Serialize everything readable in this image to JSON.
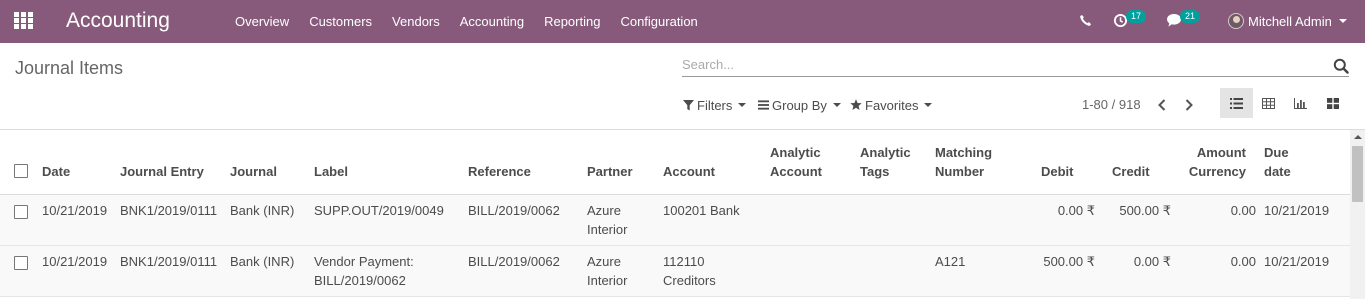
{
  "navbar": {
    "app_title": "Accounting",
    "menu": [
      "Overview",
      "Customers",
      "Vendors",
      "Accounting",
      "Reporting",
      "Configuration"
    ],
    "activity_count": "17",
    "message_count": "21",
    "user_name": "Mitchell Admin",
    "bg_color": "#875a7b",
    "badge_color": "#00a09d"
  },
  "control_panel": {
    "title": "Journal Items",
    "search_placeholder": "Search...",
    "filters_label": "Filters",
    "group_by_label": "Group By",
    "favorites_label": "Favorites",
    "pager": "1-80 / 918",
    "views": [
      "list-view-icon",
      "pivot-view-icon",
      "graph-view-icon",
      "kanban-view-icon"
    ]
  },
  "table": {
    "headers": {
      "date": "Date",
      "journal_entry": "Journal Entry",
      "journal": "Journal",
      "label": "Label",
      "reference": "Reference",
      "partner": "Partner",
      "account": "Account",
      "analytic_account": [
        "Analytic",
        "Account"
      ],
      "analytic_tags": [
        "Analytic",
        "Tags"
      ],
      "matching_number": [
        "Matching",
        "Number"
      ],
      "debit": "Debit",
      "credit": "Credit",
      "amount_currency": [
        "Amount",
        "Currency"
      ],
      "due_date": [
        "Due",
        "date"
      ]
    },
    "rows": [
      {
        "date": "10/21/2019",
        "journal_entry": "BNK1/2019/0111",
        "journal": "Bank (INR)",
        "label": [
          "SUPP.OUT/2019/0049",
          ""
        ],
        "reference": "BILL/2019/0062",
        "partner": [
          "Azure",
          "Interior"
        ],
        "account": [
          "100201 Bank",
          ""
        ],
        "analytic_account": "",
        "analytic_tags": "",
        "matching_number": "",
        "debit": "0.00 ₹",
        "credit": "500.00 ₹",
        "amount_currency": "0.00",
        "due_date": "10/21/2019"
      },
      {
        "date": "10/21/2019",
        "journal_entry": "BNK1/2019/0111",
        "journal": "Bank (INR)",
        "label": [
          "Vendor Payment:",
          "BILL/2019/0062"
        ],
        "reference": "BILL/2019/0062",
        "partner": [
          "Azure",
          "Interior"
        ],
        "account": [
          "112110",
          "Creditors"
        ],
        "analytic_account": "",
        "analytic_tags": "",
        "matching_number": "A121",
        "debit": "500.00 ₹",
        "credit": "0.00 ₹",
        "amount_currency": "0.00",
        "due_date": "10/21/2019"
      }
    ]
  }
}
